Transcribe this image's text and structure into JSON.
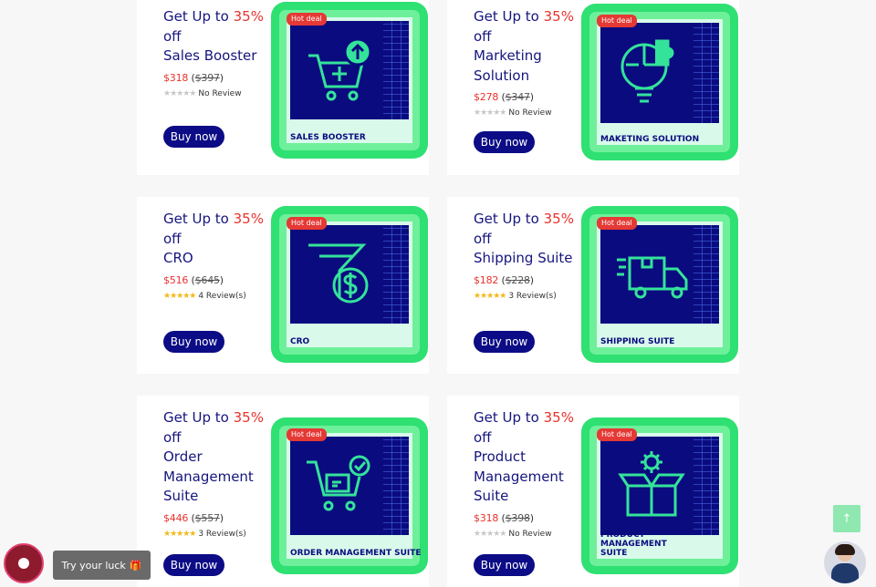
{
  "products": [
    {
      "prefix": "Get Up to ",
      "discount": "35%",
      "suffix": "off",
      "name": "Sales Booster",
      "price": "$318",
      "old_price": "$397",
      "reviews": "No Review",
      "badge": "Hot deal",
      "label": "SALES BOOSTER",
      "button": "Buy now",
      "icon": "cart-upload-icon",
      "rated": false
    },
    {
      "prefix": "Get Up to ",
      "discount": "35%",
      "suffix": "off",
      "name": "Marketing Solution",
      "price": "$278",
      "old_price": "$347",
      "reviews": "No Review",
      "badge": "Hot deal",
      "label": "MAKETING SOLUTION",
      "button": "Buy now",
      "icon": "lightbulb-puzzle-icon",
      "rated": false
    },
    {
      "prefix": "Get Up to ",
      "discount": "35%",
      "suffix": "off",
      "name": "CRO",
      "price": "$516",
      "old_price": "$645",
      "reviews": "4 Review(s)",
      "badge": "Hot deal",
      "label": "CRO",
      "button": "Buy now",
      "icon": "funnel-dollar-icon",
      "rated": true
    },
    {
      "prefix": "Get Up to ",
      "discount": "35%",
      "suffix": "off",
      "name": "Shipping Suite",
      "price": "$182",
      "old_price": "$228",
      "reviews": "3 Review(s)",
      "badge": "Hot deal",
      "label": "SHIPPING SUITE",
      "button": "Buy now",
      "icon": "delivery-truck-icon",
      "rated": true
    },
    {
      "prefix": "Get Up to ",
      "discount": "35%",
      "suffix": "off",
      "name": "Order Management Suite",
      "price": "$446",
      "old_price": "$557",
      "reviews": "3 Review(s)",
      "badge": "Hot deal",
      "label": "ORDER MANAGEMENT SUITE",
      "button": "Buy now",
      "icon": "cart-checkmark-icon",
      "rated": true
    },
    {
      "prefix": "Get Up to ",
      "discount": "35%",
      "suffix": "off",
      "name": "Product Management Suite",
      "price": "$318",
      "old_price": "$398",
      "reviews": "No Review",
      "badge": "Hot deal",
      "label": "PRODUCT MANAGEMENT SUITE",
      "button": "Buy now",
      "icon": "box-gear-icon",
      "rated": false
    }
  ],
  "widgets": {
    "luck_label": "Try your luck",
    "luck_icon": "gift-icon",
    "scroll_top_icon": "arrow-up-icon",
    "chat_avatar": "support-agent-avatar"
  },
  "colors": {
    "accent_red": "#e8322d",
    "navy": "#0c0c86",
    "thumb_green": "#2fe072"
  }
}
